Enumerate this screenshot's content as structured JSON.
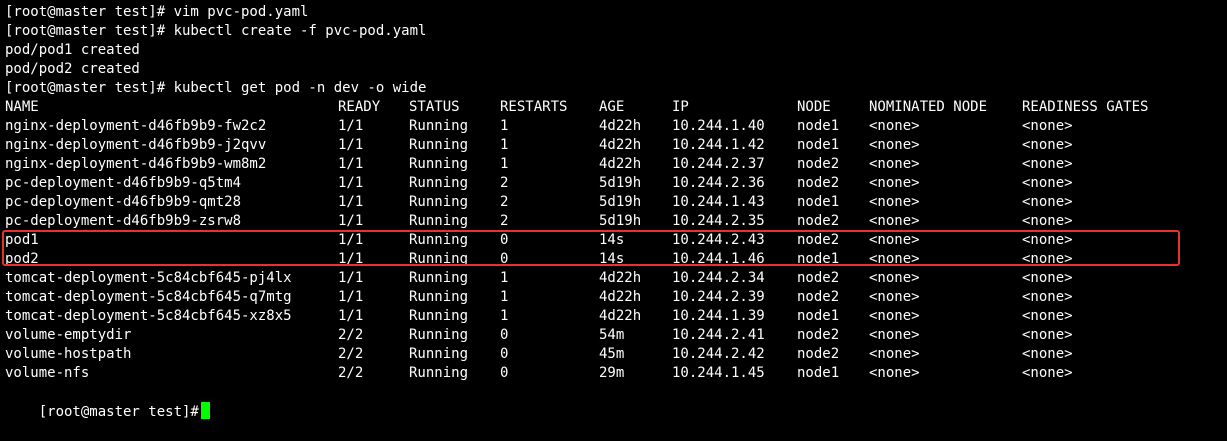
{
  "colors": {
    "background": "#000000",
    "text": "#ffffff",
    "cursor": "#00ff00",
    "highlight_border": "#e8322c"
  },
  "commands": [
    "[root@master test]# vim pvc-pod.yaml",
    "[root@master test]# kubectl create -f pvc-pod.yaml",
    "pod/pod1 created",
    "pod/pod2 created",
    "[root@master test]# kubectl get pod -n dev -o wide"
  ],
  "table": {
    "headers": [
      "NAME",
      "READY",
      "STATUS",
      "RESTARTS",
      "AGE",
      "IP",
      "NODE",
      "NOMINATED NODE",
      "READINESS GATES"
    ],
    "rows": [
      [
        "nginx-deployment-d46fb9b9-fw2c2",
        "1/1",
        "Running",
        "1",
        "4d22h",
        "10.244.1.40",
        "node1",
        "<none>",
        "<none>"
      ],
      [
        "nginx-deployment-d46fb9b9-j2qvv",
        "1/1",
        "Running",
        "1",
        "4d22h",
        "10.244.1.42",
        "node1",
        "<none>",
        "<none>"
      ],
      [
        "nginx-deployment-d46fb9b9-wm8m2",
        "1/1",
        "Running",
        "1",
        "4d22h",
        "10.244.2.37",
        "node2",
        "<none>",
        "<none>"
      ],
      [
        "pc-deployment-d46fb9b9-q5tm4",
        "1/1",
        "Running",
        "2",
        "5d19h",
        "10.244.2.36",
        "node2",
        "<none>",
        "<none>"
      ],
      [
        "pc-deployment-d46fb9b9-qmt28",
        "1/1",
        "Running",
        "2",
        "5d19h",
        "10.244.1.43",
        "node1",
        "<none>",
        "<none>"
      ],
      [
        "pc-deployment-d46fb9b9-zsrw8",
        "1/1",
        "Running",
        "2",
        "5d19h",
        "10.244.2.35",
        "node2",
        "<none>",
        "<none>"
      ],
      [
        "pod1",
        "1/1",
        "Running",
        "0",
        "14s",
        "10.244.2.43",
        "node2",
        "<none>",
        "<none>"
      ],
      [
        "pod2",
        "1/1",
        "Running",
        "0",
        "14s",
        "10.244.1.46",
        "node1",
        "<none>",
        "<none>"
      ],
      [
        "tomcat-deployment-5c84cbf645-pj4lx",
        "1/1",
        "Running",
        "1",
        "4d22h",
        "10.244.2.34",
        "node2",
        "<none>",
        "<none>"
      ],
      [
        "tomcat-deployment-5c84cbf645-q7mtg",
        "1/1",
        "Running",
        "1",
        "4d22h",
        "10.244.2.39",
        "node2",
        "<none>",
        "<none>"
      ],
      [
        "tomcat-deployment-5c84cbf645-xz8x5",
        "1/1",
        "Running",
        "1",
        "4d22h",
        "10.244.1.39",
        "node1",
        "<none>",
        "<none>"
      ],
      [
        "volume-emptydir",
        "2/2",
        "Running",
        "0",
        "54m",
        "10.244.2.41",
        "node2",
        "<none>",
        "<none>"
      ],
      [
        "volume-hostpath",
        "2/2",
        "Running",
        "0",
        "45m",
        "10.244.2.42",
        "node2",
        "<none>",
        "<none>"
      ],
      [
        "volume-nfs",
        "2/2",
        "Running",
        "0",
        "29m",
        "10.244.1.45",
        "node1",
        "<none>",
        "<none>"
      ]
    ],
    "highlighted_row_names": [
      "pod1",
      "pod2"
    ]
  },
  "prompt": "[root@master test]#"
}
